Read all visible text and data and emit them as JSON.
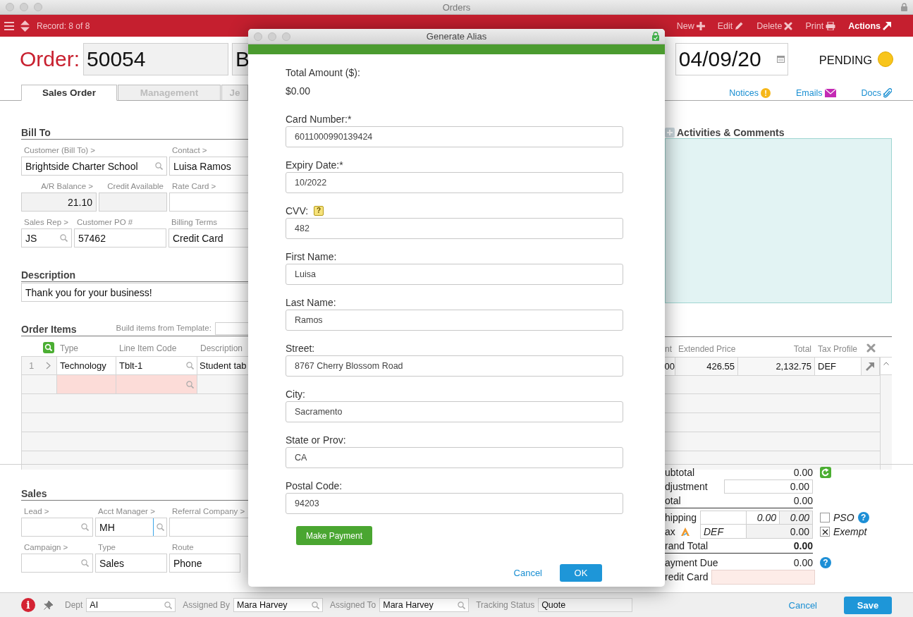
{
  "window": {
    "title": "Orders"
  },
  "toolbar": {
    "record": "Record: 8 of 8",
    "actions": [
      {
        "label": "New",
        "kind": "new"
      },
      {
        "label": "Edit",
        "kind": "edit"
      },
      {
        "label": "Delete",
        "kind": "delete"
      },
      {
        "label": "Print",
        "kind": "print"
      },
      {
        "label": "Actions",
        "kind": "actions"
      }
    ]
  },
  "header": {
    "label": "Order:",
    "order_number": "50054",
    "field_2": "B",
    "date": "04/09/20",
    "status": "PENDING"
  },
  "tabs": [
    {
      "label": "Sales Order",
      "selected": true
    },
    {
      "label": "Management",
      "selected": false
    },
    {
      "label": "Je",
      "selected": false
    }
  ],
  "links": [
    {
      "label": "Notices",
      "kind": "notices",
      "icon": "!"
    },
    {
      "label": "Emails",
      "kind": "emails"
    },
    {
      "label": "Docs",
      "kind": "docs"
    }
  ],
  "bill_to": {
    "title": "Bill To",
    "fields": [
      {
        "label": "Customer (Bill To) >",
        "value": "Brightside Charter School",
        "kind": "search"
      },
      {
        "label": "Contact >",
        "value": "Luisa Ramos",
        "kind": "text"
      },
      {
        "label": "A/R Balance >",
        "value": "21.10",
        "kind": "readonly"
      },
      {
        "label": "Credit Available",
        "kind": "readonly"
      },
      {
        "label": "Rate Card >",
        "kind": "text"
      },
      {
        "label": "Sales Rep >",
        "value": "JS",
        "kind": "search"
      },
      {
        "label": "Customer PO #",
        "value": "57462",
        "kind": "text"
      },
      {
        "label": "Billing Terms",
        "value": "Credit Card",
        "kind": "text"
      }
    ]
  },
  "description": {
    "title": "Description",
    "value": "Thank you for your business!"
  },
  "activities": {
    "title": "Activities & Comments"
  },
  "order_items": {
    "title": "Order Items",
    "template_label": "Build items from Template:",
    "columns": [
      "Type",
      "Line Item Code",
      "Description",
      "nt",
      "Extended Price",
      "Total",
      "Tax Profile"
    ],
    "rows": [
      {
        "line": "1",
        "type": "Technology",
        "code": "Tblt-1",
        "description": "Student tab",
        "column_4": "00",
        "extended_price": "426.55",
        "total": "2,132.75",
        "tax_profile": "DEF"
      }
    ]
  },
  "sales": {
    "title": "Sales",
    "fields": [
      {
        "label": "Lead >",
        "kind": "search"
      },
      {
        "label": "Acct Manager >",
        "value": "MH",
        "kind": "search",
        "focused": true
      },
      {
        "label": "Referral Company >",
        "kind": "text"
      },
      {
        "label": "Campaign >",
        "kind": "search"
      },
      {
        "label": "Type",
        "value": "Sales",
        "kind": "text"
      },
      {
        "label": "Route",
        "value": "Phone",
        "kind": "text"
      }
    ]
  },
  "totals": {
    "rows": [
      {
        "label": "ubtotal",
        "kind": "plain",
        "value": "0.00",
        "extra": {
          "kind": "refresh"
        }
      },
      {
        "label": "djustment",
        "kind": "input",
        "value": "0.00"
      },
      {
        "label": "otal",
        "kind": "sum",
        "value": "0.00"
      },
      {
        "label": "hipping",
        "kind": "shipping",
        "values": [
          "0.00",
          "0.00"
        ],
        "extra": {
          "kind": "checkbox",
          "label": "PSO",
          "checked": false,
          "help": "?"
        }
      },
      {
        "label": "ax",
        "kind": "tax",
        "profile": "DEF",
        "value": "0.00",
        "extra": {
          "kind": "checkbox",
          "label": "Exempt",
          "checked": true
        }
      },
      {
        "label": "rand Total",
        "kind": "grand",
        "value": "0.00"
      },
      {
        "label": "ayment Due",
        "kind": "plain",
        "value": "0.00",
        "extra": {
          "kind": "help",
          "help": "?"
        }
      },
      {
        "label": "redit Card",
        "kind": "credit"
      }
    ]
  },
  "footer": {
    "info": "i",
    "fields": [
      {
        "label": "Dept",
        "value": "AI",
        "kind": "search"
      },
      {
        "label": "Assigned By",
        "value": "Mara Harvey",
        "kind": "search"
      },
      {
        "label": "Assigned To",
        "value": "Mara Harvey",
        "kind": "search"
      },
      {
        "label": "Tracking Status",
        "value": "Quote",
        "kind": "readonly"
      }
    ],
    "cancel": "Cancel",
    "save": "Save"
  },
  "dialog": {
    "title": "Generate Alias",
    "total_label": "Total Amount ($):",
    "total_value": "$0.00",
    "fields": [
      {
        "label": "Card Number:*",
        "value": "6011000990139424"
      },
      {
        "label": "Expiry Date:*",
        "value": "10/2022"
      },
      {
        "label": "CVV:",
        "value": "482",
        "help": "?"
      },
      {
        "label": "First Name:",
        "value": "Luisa"
      },
      {
        "label": "Last Name:",
        "value": "Ramos"
      },
      {
        "label": "Street:",
        "value": "8767 Cherry Blossom Road"
      },
      {
        "label": "City:",
        "value": "Sacramento"
      },
      {
        "label": "State or Prov:",
        "value": "CA"
      },
      {
        "label": "Postal Code:",
        "value": "94203"
      }
    ],
    "make_payment": "Make Payment",
    "cancel": "Cancel",
    "ok": "OK"
  }
}
